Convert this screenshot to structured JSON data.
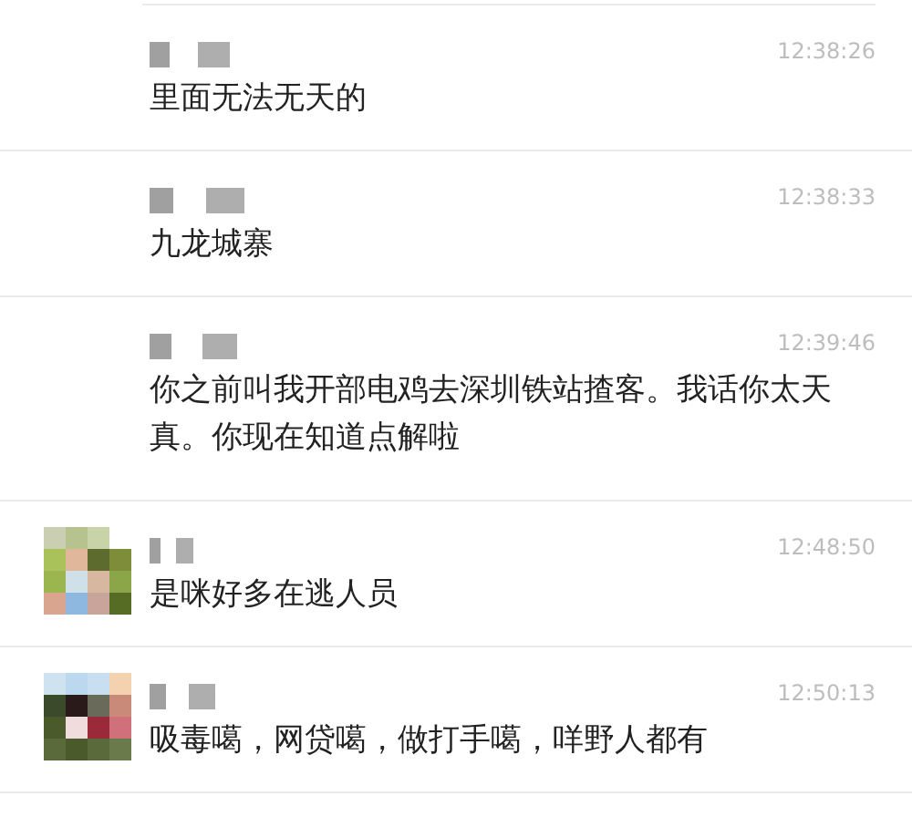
{
  "messages": [
    {
      "avatar": false,
      "time": "12:38:26",
      "text": "里面无法无天的"
    },
    {
      "avatar": false,
      "time": "12:38:33",
      "text": "九龙城寨"
    },
    {
      "avatar": false,
      "time": "12:39:46",
      "text": "你之前叫我开部电鸡去深圳铁站揸客。我话你太天真。你现在知道点解啦"
    },
    {
      "avatar": true,
      "time": "12:48:50",
      "text": "是咪好多在逃人员"
    },
    {
      "avatar": true,
      "time": "12:50:13",
      "text": "吸毒噶，网贷噶，做打手噶，咩野人都有"
    }
  ]
}
